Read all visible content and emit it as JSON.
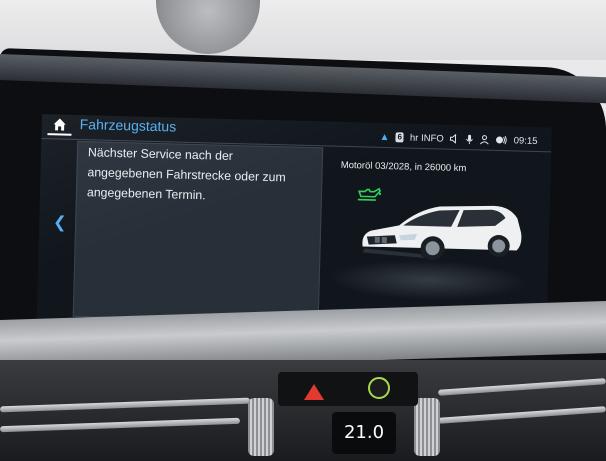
{
  "header": {
    "title": "Fahrzeugstatus",
    "status": {
      "badge": "6",
      "source": "hr INFO",
      "time": "09:15"
    }
  },
  "service": {
    "description_lines": [
      "Nächster Service nach der",
      "angegebenen Fahrstrecke oder zum",
      "angegebenen Termin."
    ],
    "item_label": "Motoröl  03/2028, in 26000 km"
  },
  "climate": {
    "temperature_display": "21.0"
  },
  "colors": {
    "accent": "#52aef2",
    "screen_bg": "#11161d",
    "panel_bg": "#273039",
    "oil_indicator": "#2fd25a",
    "hazard": "#e23a2f"
  },
  "icons": {
    "home": "home-icon",
    "up": "chevron-up-icon",
    "back": "chevron-left-icon",
    "volume": "volume-icon",
    "mic": "microphone-icon",
    "user": "user-icon",
    "phone": "phone-signal-icon",
    "oil": "oil-can-icon",
    "hazard": "hazard-icon",
    "airbag": "passenger-airbag-icon"
  }
}
